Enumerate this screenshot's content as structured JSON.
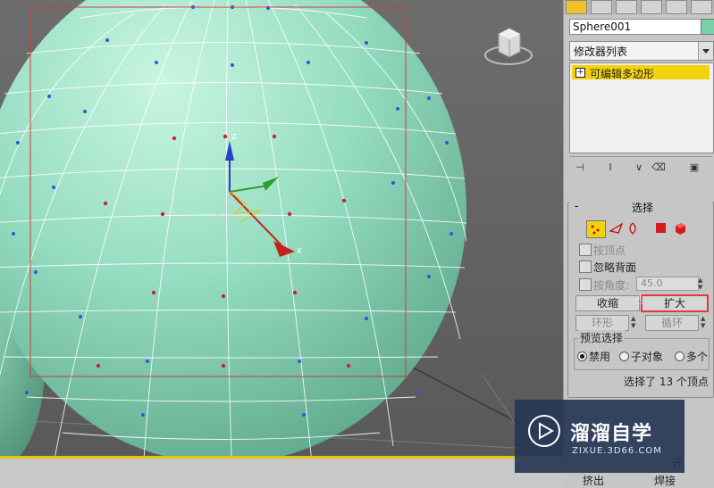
{
  "viewport": {
    "label": "viewport-perspective",
    "mesh_color": "#9be3c4"
  },
  "panel": {
    "object_name": "Sphere001",
    "modifier_list_label": "修改器列表",
    "stack_item": "可编辑多边形",
    "selection_rollout": {
      "title": "选择",
      "by_vertex": "按顶点",
      "ignore_backfacing": "忽略背面",
      "by_angle": "按角度:",
      "angle_value": "45.0",
      "shrink": "收缩",
      "grow": "扩大",
      "ring": "环形",
      "loop": "循环",
      "preview_title": "预览选择",
      "preview_disabled": "禁用",
      "preview_subobject": "子对象",
      "preview_multi": "多个",
      "status": "选择了 13 个顶点"
    },
    "bottom": {
      "extrude": "挤出",
      "weld": "焊接",
      "open_fragment": "开"
    }
  },
  "watermark": {
    "zh": "溜溜自学",
    "en": "ZIXUE.3D66.COM"
  }
}
